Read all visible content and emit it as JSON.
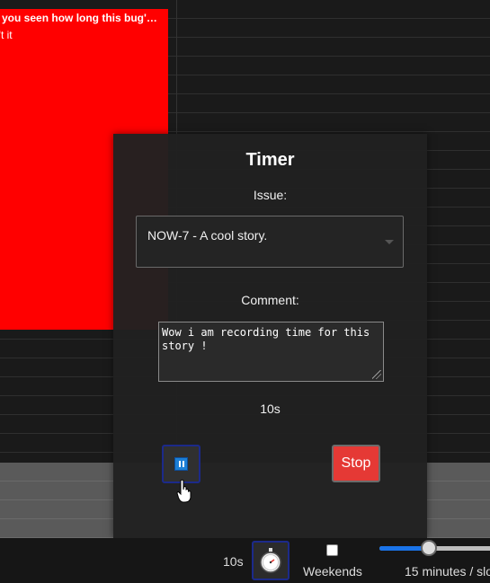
{
  "calendar": {
    "event": {
      "title": "e you seen how long this bug'…",
      "subtitle": "n't it",
      "color": "#ff0000"
    }
  },
  "timer_modal": {
    "title": "Timer",
    "issue_label": "Issue:",
    "issue_value": "NOW-7 - A cool story.",
    "comment_label": "Comment:",
    "comment_value": "Wow i am recording time for this story !",
    "elapsed": "10s",
    "pause_icon": "pause-icon",
    "stop_label": "Stop",
    "stop_color": "#e53935",
    "accent": "#1d7fd6"
  },
  "toolbar": {
    "elapsed": "10s",
    "timer_icon": "stopwatch-icon",
    "weekends_label": "Weekends",
    "weekends_checked": false,
    "slot_label": "15 minutes / slo",
    "slider_fraction": 0.4
  }
}
